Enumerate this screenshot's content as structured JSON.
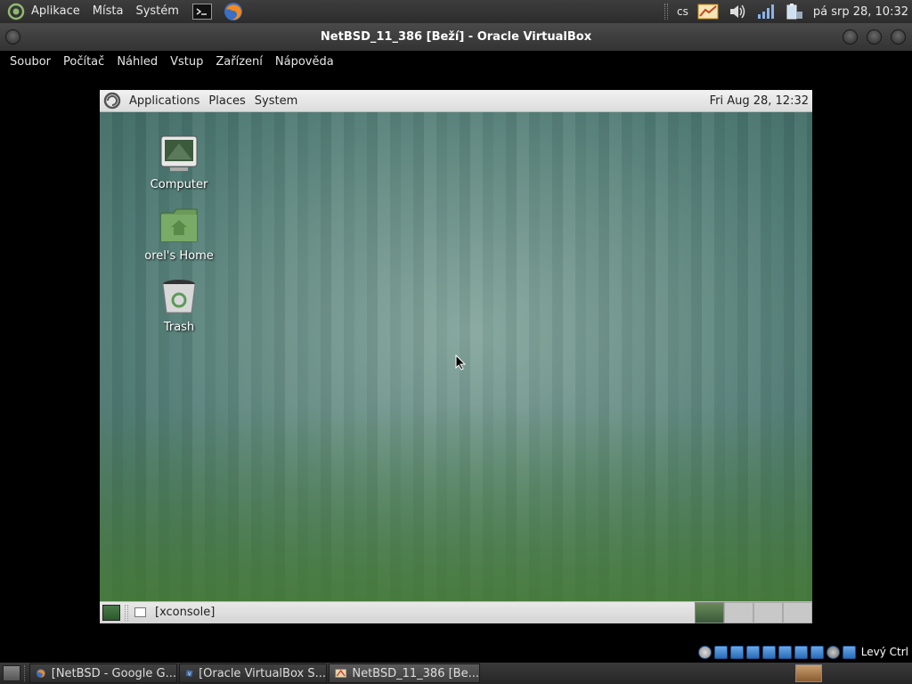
{
  "host_panel": {
    "menus": [
      "Aplikace",
      "Místa",
      "Systém"
    ],
    "keyboard_layout": "cs",
    "clock": "pá srp 28, 10:32"
  },
  "window": {
    "title": "NetBSD_11_386 [Beží] - Oracle VirtualBox"
  },
  "vbox_menu": [
    "Soubor",
    "Počítač",
    "Náhled",
    "Vstup",
    "Zařízení",
    "Nápověda"
  ],
  "guest": {
    "top_panel": {
      "menus": [
        "Applications",
        "Places",
        "System"
      ],
      "clock": "Fri Aug 28, 12:32"
    },
    "desktop_icons": [
      {
        "label": "Computer",
        "icon": "computer-icon"
      },
      {
        "label": "orel's Home",
        "icon": "home-folder-icon"
      },
      {
        "label": "Trash",
        "icon": "trash-icon"
      }
    ],
    "bottom_panel": {
      "task_label": "[xconsole]"
    }
  },
  "vbox_status": {
    "host_key": "Levý Ctrl"
  },
  "taskbar": {
    "tasks": [
      {
        "label": "[NetBSD - Google G...",
        "icon": "firefox-icon"
      },
      {
        "label": "[Oracle VirtualBox S...",
        "icon": "virtualbox-icon"
      },
      {
        "label": "NetBSD_11_386 [Be...",
        "icon": "virtualbox-window-icon"
      }
    ]
  },
  "colors": {
    "accent": "#4c7771",
    "desktop_green": "#5a8a4a"
  }
}
